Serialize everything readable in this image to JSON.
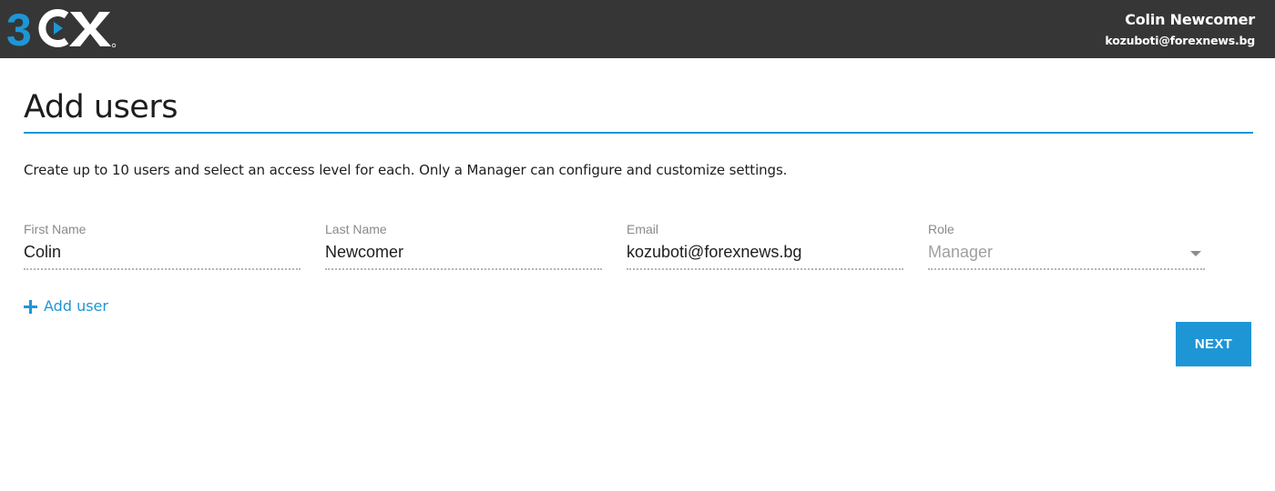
{
  "header": {
    "logo_text": "3CX",
    "user_name": "Colin Newcomer",
    "user_email": "kozuboti@forexnews.bg"
  },
  "page": {
    "title": "Add users",
    "intro": "Create up to 10 users and select an access level for each. Only a Manager can configure and customize settings."
  },
  "form": {
    "first_name": {
      "label": "First Name",
      "value": "Colin"
    },
    "last_name": {
      "label": "Last Name",
      "value": "Newcomer"
    },
    "email": {
      "label": "Email",
      "value": "kozuboti@forexnews.bg"
    },
    "role": {
      "label": "Role",
      "value": "Manager"
    }
  },
  "actions": {
    "add_user_label": "Add user",
    "next_label": "NEXT"
  },
  "colors": {
    "accent": "#1e96d5",
    "topbar": "#363636"
  }
}
